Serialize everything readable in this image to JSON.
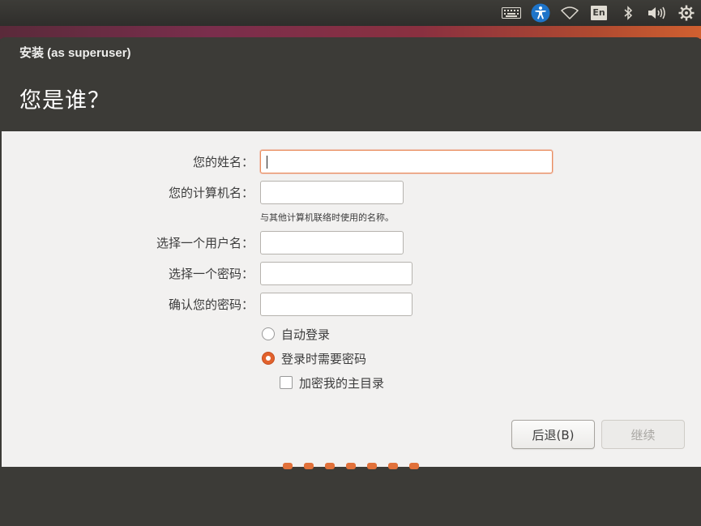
{
  "system_tray": {
    "icons": [
      "keyboard-icon",
      "accessibility-icon",
      "wifi-icon",
      "language-indicator",
      "bluetooth-icon",
      "volume-icon",
      "settings-gear-icon"
    ],
    "language": "En"
  },
  "window": {
    "title": "安装 (as superuser)",
    "heading": "您是谁？"
  },
  "form": {
    "name_label": "您的姓名：",
    "name_value": "",
    "computer_name_label": "您的计算机名：",
    "computer_name_value": "",
    "computer_name_hint": "与其他计算机联络时使用的名称。",
    "username_label": "选择一个用户名：",
    "username_value": "",
    "password_label": "选择一个密码：",
    "password_value": "",
    "confirm_password_label": "确认您的密码：",
    "confirm_password_value": ""
  },
  "login_options": {
    "auto_login_label": "自动登录",
    "auto_login_selected": false,
    "require_password_label": "登录时需要密码",
    "require_password_selected": true,
    "encrypt_home_label": "加密我的主目录",
    "encrypt_home_checked": false
  },
  "buttons": {
    "back_label": "后退(B)",
    "continue_label": "继续"
  },
  "progress": {
    "total_steps": 7,
    "dot_color": "#e1713a"
  },
  "colors": {
    "accent": "#e2622d",
    "header_bg": "#3c3b37",
    "content_bg": "#f2f1f0"
  }
}
